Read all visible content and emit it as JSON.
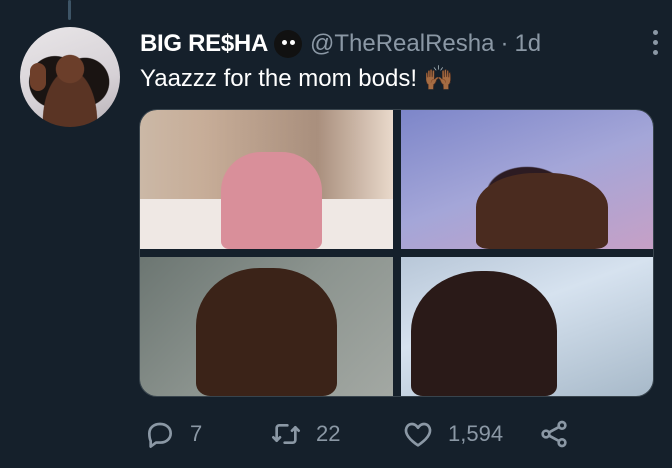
{
  "tweet": {
    "display_name": "BIG RE$HA",
    "handle": "@TheRealResha",
    "separator": "·",
    "age": "1d",
    "text": "Yaazzz for the mom bods! 🙌🏾"
  },
  "media": [
    {
      "label": "photo-1"
    },
    {
      "label": "photo-2"
    },
    {
      "label": "photo-3"
    },
    {
      "label": "photo-4"
    }
  ],
  "actions": {
    "reply_count": "7",
    "retweet_count": "22",
    "like_count": "1,594"
  },
  "colors": {
    "background": "#15202b",
    "muted": "#8b98a5",
    "text": "#ffffff"
  }
}
